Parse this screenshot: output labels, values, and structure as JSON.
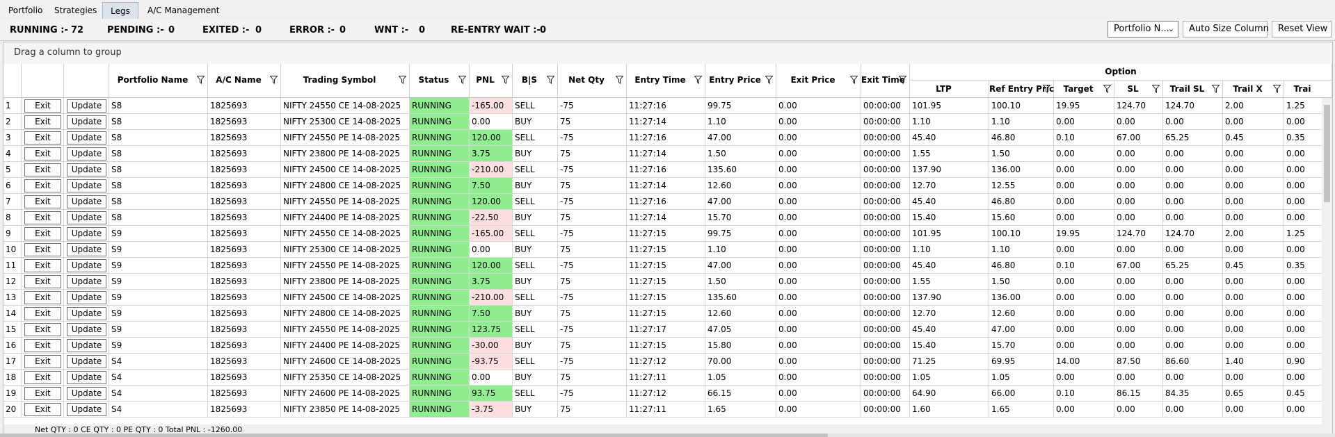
{
  "tabs": [
    "Portfolio",
    "Strategies",
    "Legs",
    "A/C Management"
  ],
  "active_tab": "Legs",
  "status_counts": [
    {
      "label": "RUNNING :-",
      "value": "72"
    },
    {
      "label": "PENDING :-",
      "value": "0"
    },
    {
      "label": "EXITED :-",
      "value": "0"
    },
    {
      "label": "ERROR :-",
      "value": "0"
    },
    {
      "label": "WNT :-",
      "value": "0"
    },
    {
      "label": "RE-ENTRY WAIT :-",
      "value": "0"
    }
  ],
  "toolbar": {
    "portfolio_select": "Portfolio N...",
    "auto_size_label": "Auto Size Column",
    "reset_view_label": "Reset View"
  },
  "group_hint": "Drag a column to group",
  "option_group_label": "Option",
  "columns": [
    "Portfolio Name",
    "A/C Name",
    "Trading Symbol",
    "Status",
    "PNL",
    "B|S",
    "Net Qty",
    "Entry Time",
    "Entry Price",
    "Exit Price",
    "Exit Time",
    "LTP",
    "Ref Entry Price",
    "Target",
    "SL",
    "Trail SL",
    "Trail X",
    "Trai"
  ],
  "row_buttons": {
    "exit": "Exit",
    "update": "Update"
  },
  "colors": {
    "running_bg": "#90ee90",
    "pnl_positive_bg": "#90ee90",
    "pnl_negative_bg": "#ffe0e0"
  },
  "rows": [
    {
      "n": "1",
      "portfolio": "S8",
      "ac": "1825693",
      "symbol": "NIFTY 24550 CE 14-08-2025",
      "status": "RUNNING",
      "pnl": "-165.00",
      "bs": "SELL",
      "qty": "-75",
      "entry_time": "11:27:16",
      "entry_price": "99.75",
      "exit_price": "0.00",
      "exit_time": "00:00:00",
      "ltp": "101.95",
      "ref_entry": "100.10",
      "target": "19.95",
      "sl": "124.70",
      "trail_sl": "124.70",
      "trail_x": "2.00",
      "trai": "1.25"
    },
    {
      "n": "2",
      "portfolio": "S8",
      "ac": "1825693",
      "symbol": "NIFTY 25300 CE 14-08-2025",
      "status": "RUNNING",
      "pnl": "0.00",
      "bs": "BUY",
      "qty": "75",
      "entry_time": "11:27:14",
      "entry_price": "1.10",
      "exit_price": "0.00",
      "exit_time": "00:00:00",
      "ltp": "1.10",
      "ref_entry": "1.10",
      "target": "0.00",
      "sl": "0.00",
      "trail_sl": "0.00",
      "trail_x": "0.00",
      "trai": "0.00"
    },
    {
      "n": "3",
      "portfolio": "S8",
      "ac": "1825693",
      "symbol": "NIFTY 24550 PE 14-08-2025",
      "status": "RUNNING",
      "pnl": "120.00",
      "bs": "SELL",
      "qty": "-75",
      "entry_time": "11:27:16",
      "entry_price": "47.00",
      "exit_price": "0.00",
      "exit_time": "00:00:00",
      "ltp": "45.40",
      "ref_entry": "46.80",
      "target": "0.10",
      "sl": "67.00",
      "trail_sl": "65.25",
      "trail_x": "0.45",
      "trai": "0.35"
    },
    {
      "n": "4",
      "portfolio": "S8",
      "ac": "1825693",
      "symbol": "NIFTY 23800 PE 14-08-2025",
      "status": "RUNNING",
      "pnl": "3.75",
      "bs": "BUY",
      "qty": "75",
      "entry_time": "11:27:14",
      "entry_price": "1.50",
      "exit_price": "0.00",
      "exit_time": "00:00:00",
      "ltp": "1.55",
      "ref_entry": "1.50",
      "target": "0.00",
      "sl": "0.00",
      "trail_sl": "0.00",
      "trail_x": "0.00",
      "trai": "0.00"
    },
    {
      "n": "5",
      "portfolio": "S8",
      "ac": "1825693",
      "symbol": "NIFTY 24500 CE 14-08-2025",
      "status": "RUNNING",
      "pnl": "-210.00",
      "bs": "SELL",
      "qty": "-75",
      "entry_time": "11:27:16",
      "entry_price": "135.60",
      "exit_price": "0.00",
      "exit_time": "00:00:00",
      "ltp": "137.90",
      "ref_entry": "136.00",
      "target": "0.00",
      "sl": "0.00",
      "trail_sl": "0.00",
      "trail_x": "0.00",
      "trai": "0.00"
    },
    {
      "n": "6",
      "portfolio": "S8",
      "ac": "1825693",
      "symbol": "NIFTY 24800 CE 14-08-2025",
      "status": "RUNNING",
      "pnl": "7.50",
      "bs": "BUY",
      "qty": "75",
      "entry_time": "11:27:14",
      "entry_price": "12.60",
      "exit_price": "0.00",
      "exit_time": "00:00:00",
      "ltp": "12.70",
      "ref_entry": "12.55",
      "target": "0.00",
      "sl": "0.00",
      "trail_sl": "0.00",
      "trail_x": "0.00",
      "trai": "0.00"
    },
    {
      "n": "7",
      "portfolio": "S8",
      "ac": "1825693",
      "symbol": "NIFTY 24550 PE 14-08-2025",
      "status": "RUNNING",
      "pnl": "120.00",
      "bs": "SELL",
      "qty": "-75",
      "entry_time": "11:27:16",
      "entry_price": "47.00",
      "exit_price": "0.00",
      "exit_time": "00:00:00",
      "ltp": "45.40",
      "ref_entry": "46.80",
      "target": "0.00",
      "sl": "0.00",
      "trail_sl": "0.00",
      "trail_x": "0.00",
      "trai": "0.00"
    },
    {
      "n": "8",
      "portfolio": "S8",
      "ac": "1825693",
      "symbol": "NIFTY 24400 PE 14-08-2025",
      "status": "RUNNING",
      "pnl": "-22.50",
      "bs": "BUY",
      "qty": "75",
      "entry_time": "11:27:14",
      "entry_price": "15.70",
      "exit_price": "0.00",
      "exit_time": "00:00:00",
      "ltp": "15.40",
      "ref_entry": "15.60",
      "target": "0.00",
      "sl": "0.00",
      "trail_sl": "0.00",
      "trail_x": "0.00",
      "trai": "0.00"
    },
    {
      "n": "9",
      "portfolio": "S9",
      "ac": "1825693",
      "symbol": "NIFTY 24550 CE 14-08-2025",
      "status": "RUNNING",
      "pnl": "-165.00",
      "bs": "SELL",
      "qty": "-75",
      "entry_time": "11:27:15",
      "entry_price": "99.75",
      "exit_price": "0.00",
      "exit_time": "00:00:00",
      "ltp": "101.95",
      "ref_entry": "100.10",
      "target": "19.95",
      "sl": "124.70",
      "trail_sl": "124.70",
      "trail_x": "2.00",
      "trai": "1.25"
    },
    {
      "n": "10",
      "portfolio": "S9",
      "ac": "1825693",
      "symbol": "NIFTY 25300 CE 14-08-2025",
      "status": "RUNNING",
      "pnl": "0.00",
      "bs": "BUY",
      "qty": "75",
      "entry_time": "11:27:15",
      "entry_price": "1.10",
      "exit_price": "0.00",
      "exit_time": "00:00:00",
      "ltp": "1.10",
      "ref_entry": "1.10",
      "target": "0.00",
      "sl": "0.00",
      "trail_sl": "0.00",
      "trail_x": "0.00",
      "trai": "0.00"
    },
    {
      "n": "11",
      "portfolio": "S9",
      "ac": "1825693",
      "symbol": "NIFTY 24550 PE 14-08-2025",
      "status": "RUNNING",
      "pnl": "120.00",
      "bs": "SELL",
      "qty": "-75",
      "entry_time": "11:27:15",
      "entry_price": "47.00",
      "exit_price": "0.00",
      "exit_time": "00:00:00",
      "ltp": "45.40",
      "ref_entry": "46.80",
      "target": "0.10",
      "sl": "67.00",
      "trail_sl": "65.25",
      "trail_x": "0.45",
      "trai": "0.35"
    },
    {
      "n": "12",
      "portfolio": "S9",
      "ac": "1825693",
      "symbol": "NIFTY 23800 PE 14-08-2025",
      "status": "RUNNING",
      "pnl": "3.75",
      "bs": "BUY",
      "qty": "75",
      "entry_time": "11:27:15",
      "entry_price": "1.50",
      "exit_price": "0.00",
      "exit_time": "00:00:00",
      "ltp": "1.55",
      "ref_entry": "1.50",
      "target": "0.00",
      "sl": "0.00",
      "trail_sl": "0.00",
      "trail_x": "0.00",
      "trai": "0.00"
    },
    {
      "n": "13",
      "portfolio": "S9",
      "ac": "1825693",
      "symbol": "NIFTY 24500 CE 14-08-2025",
      "status": "RUNNING",
      "pnl": "-210.00",
      "bs": "SELL",
      "qty": "-75",
      "entry_time": "11:27:15",
      "entry_price": "135.60",
      "exit_price": "0.00",
      "exit_time": "00:00:00",
      "ltp": "137.90",
      "ref_entry": "136.00",
      "target": "0.00",
      "sl": "0.00",
      "trail_sl": "0.00",
      "trail_x": "0.00",
      "trai": "0.00"
    },
    {
      "n": "14",
      "portfolio": "S9",
      "ac": "1825693",
      "symbol": "NIFTY 24800 CE 14-08-2025",
      "status": "RUNNING",
      "pnl": "7.50",
      "bs": "BUY",
      "qty": "75",
      "entry_time": "11:27:15",
      "entry_price": "12.60",
      "exit_price": "0.00",
      "exit_time": "00:00:00",
      "ltp": "12.70",
      "ref_entry": "12.60",
      "target": "0.00",
      "sl": "0.00",
      "trail_sl": "0.00",
      "trail_x": "0.00",
      "trai": "0.00"
    },
    {
      "n": "15",
      "portfolio": "S9",
      "ac": "1825693",
      "symbol": "NIFTY 24550 PE 14-08-2025",
      "status": "RUNNING",
      "pnl": "123.75",
      "bs": "SELL",
      "qty": "-75",
      "entry_time": "11:27:17",
      "entry_price": "47.05",
      "exit_price": "0.00",
      "exit_time": "00:00:00",
      "ltp": "45.40",
      "ref_entry": "47.00",
      "target": "0.00",
      "sl": "0.00",
      "trail_sl": "0.00",
      "trail_x": "0.00",
      "trai": "0.00"
    },
    {
      "n": "16",
      "portfolio": "S9",
      "ac": "1825693",
      "symbol": "NIFTY 24400 PE 14-08-2025",
      "status": "RUNNING",
      "pnl": "-30.00",
      "bs": "BUY",
      "qty": "75",
      "entry_time": "11:27:15",
      "entry_price": "15.80",
      "exit_price": "0.00",
      "exit_time": "00:00:00",
      "ltp": "15.40",
      "ref_entry": "15.70",
      "target": "0.00",
      "sl": "0.00",
      "trail_sl": "0.00",
      "trail_x": "0.00",
      "trai": "0.00"
    },
    {
      "n": "17",
      "portfolio": "S4",
      "ac": "1825693",
      "symbol": "NIFTY 24600 CE 14-08-2025",
      "status": "RUNNING",
      "pnl": "-93.75",
      "bs": "SELL",
      "qty": "-75",
      "entry_time": "11:27:12",
      "entry_price": "70.00",
      "exit_price": "0.00",
      "exit_time": "00:00:00",
      "ltp": "71.25",
      "ref_entry": "69.95",
      "target": "14.00",
      "sl": "87.50",
      "trail_sl": "86.60",
      "trail_x": "1.40",
      "trai": "0.90"
    },
    {
      "n": "18",
      "portfolio": "S4",
      "ac": "1825693",
      "symbol": "NIFTY 25350 CE 14-08-2025",
      "status": "RUNNING",
      "pnl": "0.00",
      "bs": "BUY",
      "qty": "75",
      "entry_time": "11:27:11",
      "entry_price": "1.05",
      "exit_price": "0.00",
      "exit_time": "00:00:00",
      "ltp": "1.05",
      "ref_entry": "1.05",
      "target": "0.00",
      "sl": "0.00",
      "trail_sl": "0.00",
      "trail_x": "0.00",
      "trai": "0.00"
    },
    {
      "n": "19",
      "portfolio": "S4",
      "ac": "1825693",
      "symbol": "NIFTY 24600 PE 14-08-2025",
      "status": "RUNNING",
      "pnl": "93.75",
      "bs": "SELL",
      "qty": "-75",
      "entry_time": "11:27:12",
      "entry_price": "66.15",
      "exit_price": "0.00",
      "exit_time": "00:00:00",
      "ltp": "64.90",
      "ref_entry": "66.00",
      "target": "0.10",
      "sl": "86.15",
      "trail_sl": "84.35",
      "trail_x": "0.65",
      "trai": "0.45"
    },
    {
      "n": "20",
      "portfolio": "S4",
      "ac": "1825693",
      "symbol": "NIFTY 23850 PE 14-08-2025",
      "status": "RUNNING",
      "pnl": "-3.75",
      "bs": "BUY",
      "qty": "75",
      "entry_time": "11:27:11",
      "entry_price": "1.65",
      "exit_price": "0.00",
      "exit_time": "00:00:00",
      "ltp": "1.60",
      "ref_entry": "1.65",
      "target": "0.00",
      "sl": "0.00",
      "trail_sl": "0.00",
      "trail_x": "0.00",
      "trai": "0.00"
    }
  ],
  "footer_summary": "Net QTY : 0 CE QTY : 0 PE QTY : 0  Total PNL : -1260.00"
}
